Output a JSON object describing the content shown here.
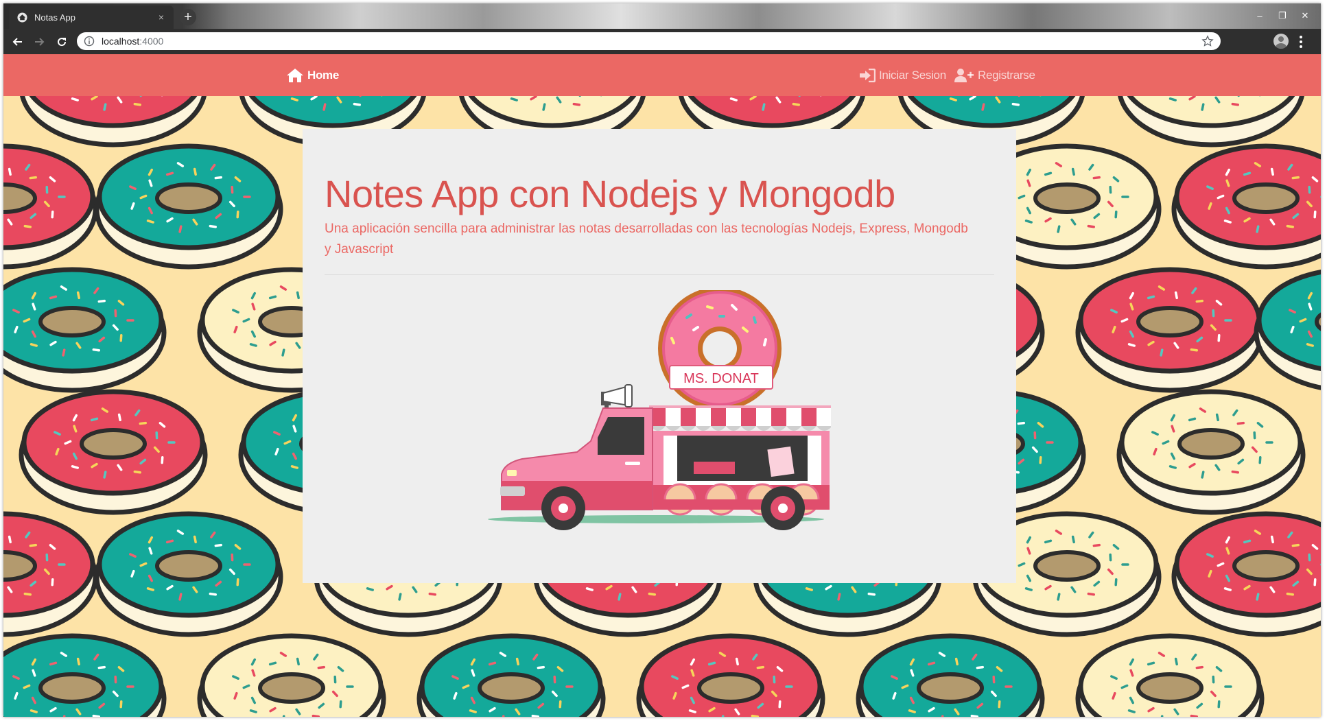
{
  "browser": {
    "tab_title": "Notas App",
    "tab_close": "×",
    "new_tab": "+",
    "url_host": "localhost",
    "url_port": ":4000",
    "window_controls": {
      "minimize": "–",
      "restore": "❐",
      "close": "✕"
    }
  },
  "navbar": {
    "home": {
      "label": "Home",
      "icon": "home-icon"
    },
    "login": {
      "label": "Iniciar Sesion",
      "icon": "sign-in-icon"
    },
    "register": {
      "label": "Registrarse",
      "icon": "user-plus-icon"
    }
  },
  "jumbotron": {
    "title": "Notes App con Nodejs y Mongodb",
    "lead": "Una aplicación sencilla para administrar las notas desarrolladas con las tecnologías Nodejs, Express, Mongodb y Javascript",
    "image": {
      "sign_text": "MS. DONAT",
      "description": "food-truck-illustration"
    }
  },
  "colors": {
    "navbar": "#eb6864",
    "title": "#d9534f",
    "lead": "#eb6864",
    "background": "#fde3a7",
    "card": "#eeeeee"
  }
}
